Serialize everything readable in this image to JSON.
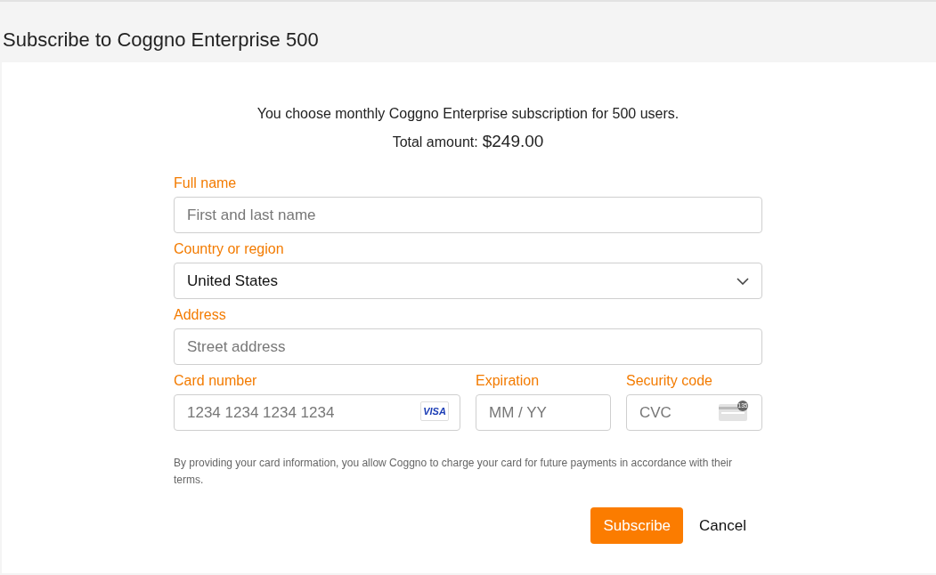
{
  "page_title": "Subscribe to Coggno Enterprise 500",
  "summary": {
    "description": "You choose monthly Coggno Enterprise subscription for 500 users.",
    "total_label": "Total amount:",
    "total_value": "$249.00"
  },
  "fields": [
    {
      "label": "Full name",
      "kind": "text",
      "placeholder": "First and last name"
    },
    {
      "label": "Country or region",
      "kind": "select",
      "value": "United States"
    },
    {
      "label": "Address",
      "kind": "text",
      "placeholder": "Street address"
    }
  ],
  "card_fields": [
    {
      "label": "Card number",
      "kind": "card",
      "placeholder": "1234 1234 1234 1234",
      "badge": "VISA"
    },
    {
      "label": "Expiration",
      "kind": "text",
      "placeholder": "MM / YY"
    },
    {
      "label": "Security code",
      "kind": "cvc",
      "placeholder": "CVC",
      "badge": "135"
    }
  ],
  "disclaimer": "By providing your card information, you allow Coggno to charge your card for future payments in accordance with their terms.",
  "buttons": [
    {
      "label": "Subscribe",
      "kind": "primary"
    },
    {
      "label": "Cancel",
      "kind": "plain"
    }
  ]
}
